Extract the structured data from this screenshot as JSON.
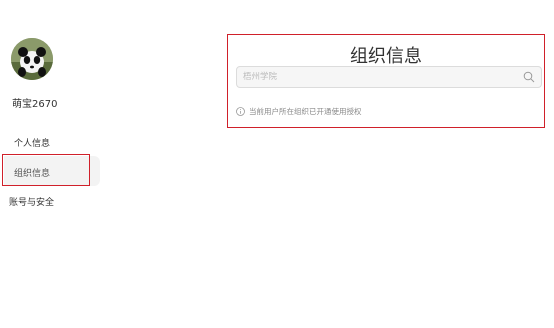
{
  "user": {
    "name": "萌宝2670"
  },
  "sidebar": {
    "items": [
      {
        "label": "个人信息"
      },
      {
        "label": "组织信息"
      },
      {
        "label": "账号与安全"
      }
    ]
  },
  "main": {
    "title": "组织信息",
    "search": {
      "placeholder": "梧州学院",
      "value": ""
    },
    "notice": "当前用户所在组织已开通使用授权"
  },
  "colors": {
    "highlight": "#d0202a",
    "active_bg": "#f3f3f3"
  },
  "icons": {
    "search": "search-icon",
    "info": "info-icon",
    "avatar": "panda-avatar"
  }
}
